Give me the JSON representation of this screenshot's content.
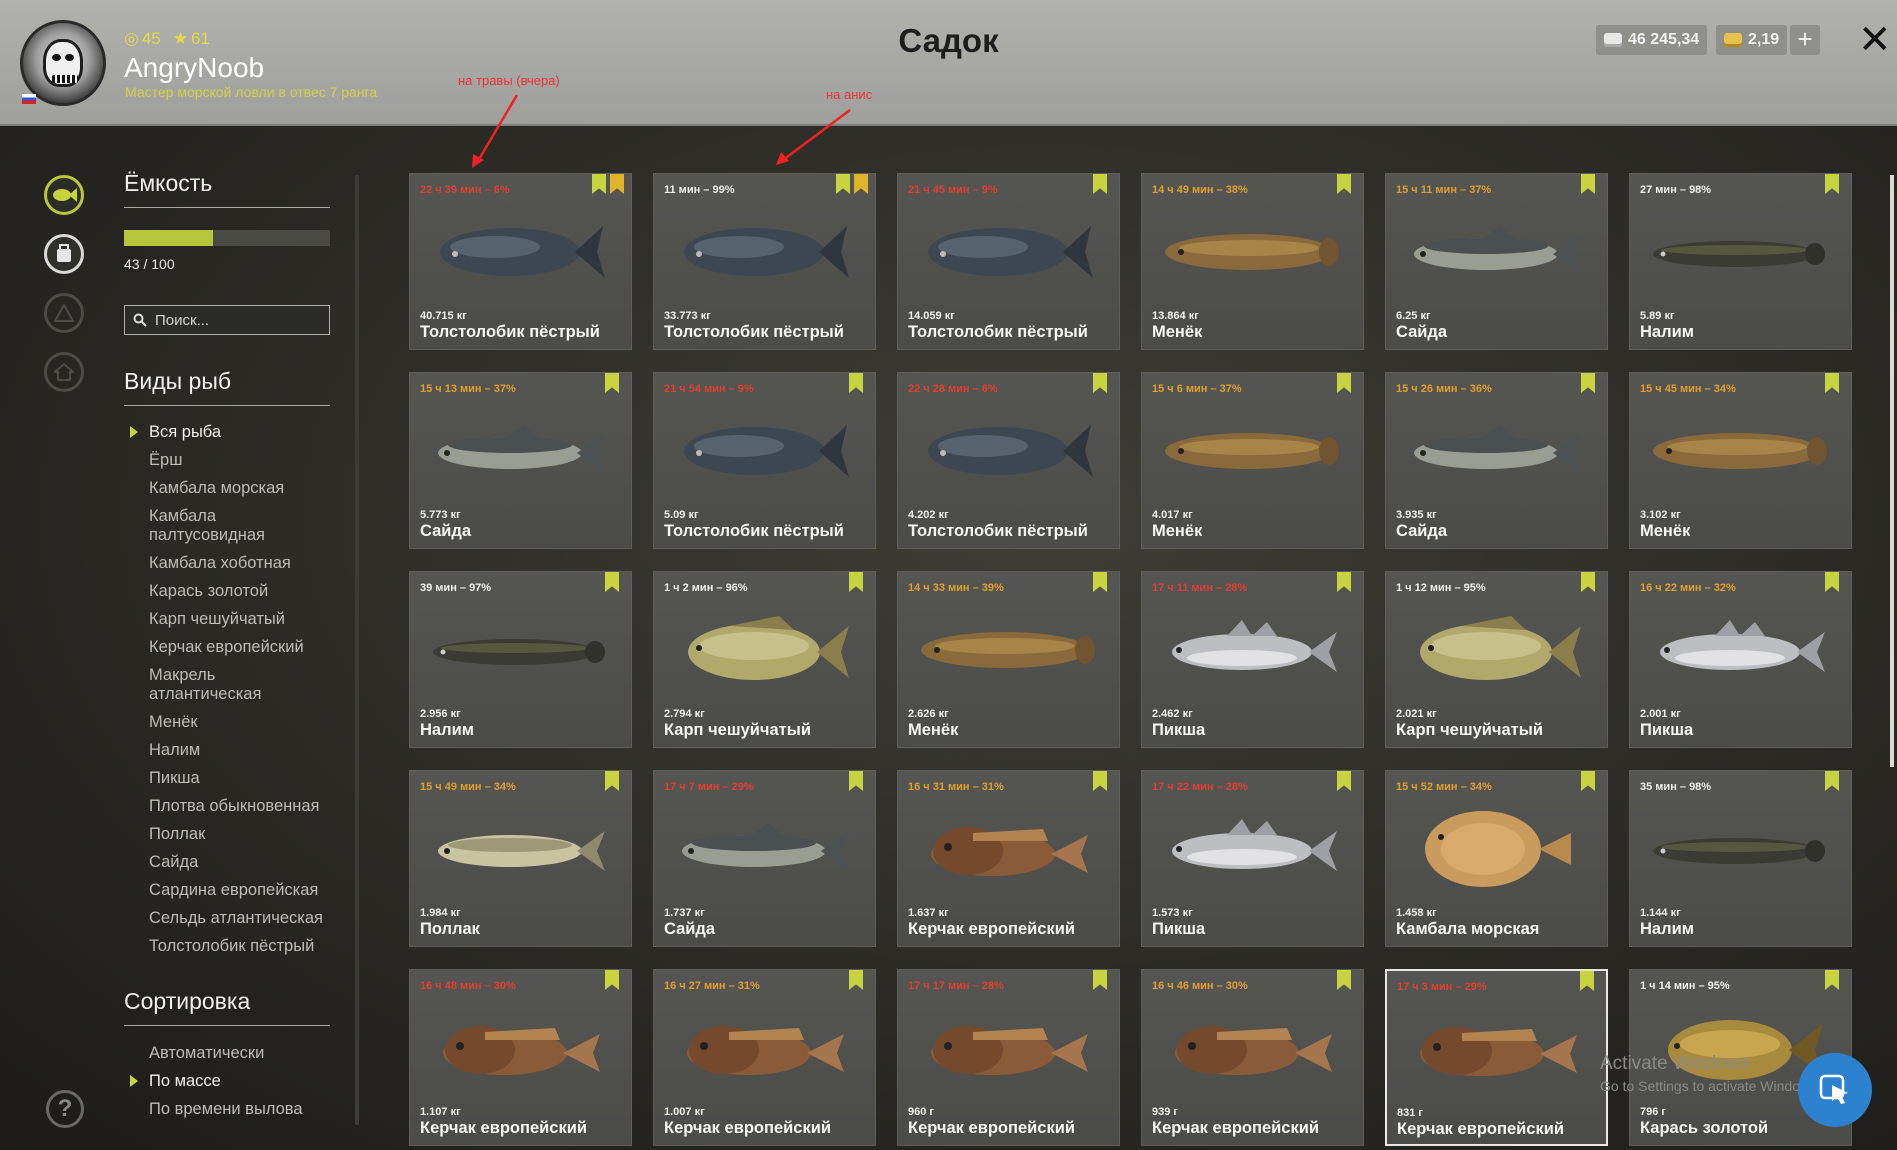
{
  "header": {
    "title": "Садок",
    "player": {
      "level": "45",
      "stars": "61",
      "name": "AngryNoob",
      "rank": "Мастер морской ловли в отвес 7 ранга"
    },
    "silver": "46 245,34",
    "gold": "2,19",
    "add_label": "+",
    "close_label": "✕"
  },
  "annotations": [
    {
      "text": "на травы (вчера)"
    },
    {
      "text": "на анис"
    }
  ],
  "capacity": {
    "title": "Ёмкость",
    "used": 43,
    "total": 100,
    "text": "43 / 100"
  },
  "search": {
    "placeholder": "Поиск..."
  },
  "species": {
    "title": "Виды рыб",
    "items": [
      {
        "label": "Вся рыба",
        "selected": true
      },
      {
        "label": "Ёрш"
      },
      {
        "label": "Камбала морская"
      },
      {
        "label": "Камбала палтусовидная"
      },
      {
        "label": "Камбала хоботная"
      },
      {
        "label": "Карась золотой"
      },
      {
        "label": "Карп чешуйчатый"
      },
      {
        "label": "Керчак европейский"
      },
      {
        "label": "Макрель атлантическая"
      },
      {
        "label": "Менёк"
      },
      {
        "label": "Налим"
      },
      {
        "label": "Пикша"
      },
      {
        "label": "Плотва обыкновенная"
      },
      {
        "label": "Поллак"
      },
      {
        "label": "Сайда"
      },
      {
        "label": "Сардина европейская"
      },
      {
        "label": "Сельдь атлантическая"
      },
      {
        "label": "Толстолобик пёстрый"
      }
    ]
  },
  "sorting": {
    "title": "Сортировка",
    "items": [
      {
        "label": "Автоматически"
      },
      {
        "label": "По массе",
        "selected": true
      },
      {
        "label": "По времени вылова"
      }
    ]
  },
  "fish": [
    {
      "timer": "22 ч 39 мин – 6%",
      "color": "red",
      "weight": "40.715 кг",
      "name": "Толстолобик пёстрый",
      "kind": "carp-big",
      "star": true
    },
    {
      "timer": "11 мин – 99%",
      "color": "white",
      "weight": "33.773 кг",
      "name": "Толстолобик пёстрый",
      "kind": "carp-big",
      "star": true
    },
    {
      "timer": "21 ч 45 мин – 9%",
      "color": "red",
      "weight": "14.059 кг",
      "name": "Толстолобик пёстрый",
      "kind": "carp-big"
    },
    {
      "timer": "14 ч 49 мин – 38%",
      "color": "orange",
      "weight": "13.864 кг",
      "name": "Менёк",
      "kind": "eel"
    },
    {
      "timer": "15 ч 11 мин – 37%",
      "color": "orange",
      "weight": "6.25 кг",
      "name": "Сайда",
      "kind": "saithe"
    },
    {
      "timer": "27 мин – 98%",
      "color": "white",
      "weight": "5.89 кг",
      "name": "Налим",
      "kind": "burbot"
    },
    {
      "timer": "15 ч 13 мин – 37%",
      "color": "orange",
      "weight": "5.773 кг",
      "name": "Сайда",
      "kind": "saithe"
    },
    {
      "timer": "21 ч 54 мин – 9%",
      "color": "red",
      "weight": "5.09 кг",
      "name": "Толстолобик пёстрый",
      "kind": "carp-big"
    },
    {
      "timer": "22 ч 28 мин – 6%",
      "color": "red",
      "weight": "4.202 кг",
      "name": "Толстолобик пёстрый",
      "kind": "carp-big"
    },
    {
      "timer": "15 ч 6 мин – 37%",
      "color": "orange",
      "weight": "4.017 кг",
      "name": "Менёк",
      "kind": "eel"
    },
    {
      "timer": "15 ч 26 мин – 36%",
      "color": "orange",
      "weight": "3.935 кг",
      "name": "Сайда",
      "kind": "saithe"
    },
    {
      "timer": "15 ч 45 мин – 34%",
      "color": "orange",
      "weight": "3.102 кг",
      "name": "Менёк",
      "kind": "eel"
    },
    {
      "timer": "39 мин – 97%",
      "color": "white",
      "weight": "2.956 кг",
      "name": "Налим",
      "kind": "burbot"
    },
    {
      "timer": "1 ч 2 мин – 96%",
      "color": "white",
      "weight": "2.794 кг",
      "name": "Карп чешуйчатый",
      "kind": "carp"
    },
    {
      "timer": "14 ч 33 мин – 39%",
      "color": "orange",
      "weight": "2.626 кг",
      "name": "Менёк",
      "kind": "eel"
    },
    {
      "timer": "17 ч 11 мин – 28%",
      "color": "red",
      "weight": "2.462 кг",
      "name": "Пикша",
      "kind": "haddock"
    },
    {
      "timer": "1 ч 12 мин – 95%",
      "color": "white",
      "weight": "2.021 кг",
      "name": "Карп чешуйчатый",
      "kind": "carp"
    },
    {
      "timer": "16 ч 22 мин – 32%",
      "color": "orange",
      "weight": "2.001 кг",
      "name": "Пикша",
      "kind": "haddock"
    },
    {
      "timer": "15 ч 49 мин – 34%",
      "color": "orange",
      "weight": "1.984 кг",
      "name": "Поллак",
      "kind": "pollack"
    },
    {
      "timer": "17 ч 7 мин – 29%",
      "color": "red",
      "weight": "1.737 кг",
      "name": "Сайда",
      "kind": "saithe"
    },
    {
      "timer": "16 ч 31 мин – 31%",
      "color": "orange",
      "weight": "1.637 кг",
      "name": "Керчак европейский",
      "kind": "sculpin"
    },
    {
      "timer": "17 ч 22 мин – 28%",
      "color": "red",
      "weight": "1.573 кг",
      "name": "Пикша",
      "kind": "haddock"
    },
    {
      "timer": "15 ч 52 мин – 34%",
      "color": "orange",
      "weight": "1.458 кг",
      "name": "Камбала морская",
      "kind": "flounder"
    },
    {
      "timer": "35 мин – 98%",
      "color": "white",
      "weight": "1.144 кг",
      "name": "Налим",
      "kind": "burbot"
    },
    {
      "timer": "16 ч 48 мин – 30%",
      "color": "red",
      "weight": "1.107 кг",
      "name": "Керчак европейский",
      "kind": "sculpin"
    },
    {
      "timer": "16 ч 27 мин – 31%",
      "color": "orange",
      "weight": "1.007 кг",
      "name": "Керчак европейский",
      "kind": "sculpin"
    },
    {
      "timer": "17 ч 17 мин – 28%",
      "color": "red",
      "weight": "960 г",
      "name": "Керчак европейский",
      "kind": "sculpin"
    },
    {
      "timer": "16 ч 46 мин – 30%",
      "color": "orange",
      "weight": "939 г",
      "name": "Керчак европейский",
      "kind": "sculpin"
    },
    {
      "timer": "17 ч 3 мин – 29%",
      "color": "red",
      "weight": "831 г",
      "name": "Керчак европейский",
      "kind": "sculpin",
      "selected": true
    },
    {
      "timer": "1 ч 14 мин – 95%",
      "color": "white",
      "weight": "796 г",
      "name": "Карась золотой",
      "kind": "crucian"
    }
  ],
  "watermark": {
    "line1": "Activate Windows",
    "line2": "Go to Settings to activate Windows."
  }
}
